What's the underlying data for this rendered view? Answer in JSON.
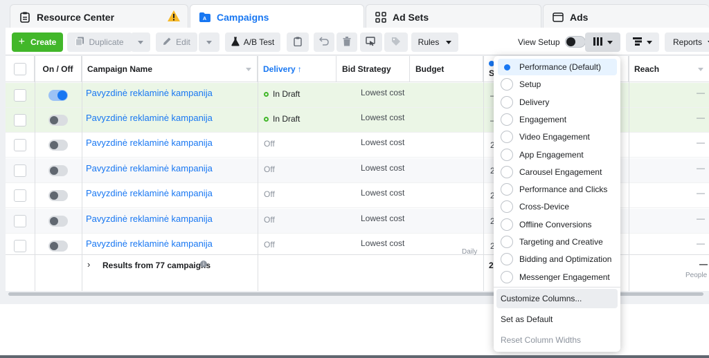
{
  "tabs": {
    "resource_center": "Resource Center",
    "campaigns": "Campaigns",
    "ad_sets": "Ad Sets",
    "ads": "Ads"
  },
  "toolbar": {
    "create": "Create",
    "duplicate": "Duplicate",
    "edit": "Edit",
    "ab_test": "A/B Test",
    "rules": "Rules",
    "view_setup": "View Setup",
    "reports": "Reports"
  },
  "table": {
    "headers": {
      "on_off": "On / Off",
      "campaign_name": "Campaign Name",
      "delivery": "Delivery",
      "bid_strategy": "Bid Strategy",
      "budget": "Budget",
      "results_partial": "S",
      "reach": "Reach"
    },
    "rows": [
      {
        "name": "Pavyzdinė reklaminė kampanija",
        "on": true,
        "delivery": "In Draft",
        "bid": "Lowest cost",
        "results": "—",
        "reach": "—"
      },
      {
        "name": "Pavyzdinė reklaminė kampanija",
        "on": false,
        "delivery": "In Draft",
        "bid": "Lowest cost",
        "results": "—",
        "reach": "—"
      },
      {
        "name": "Pavyzdinė reklaminė kampanija",
        "on": false,
        "delivery": "Off",
        "bid": "Lowest cost",
        "results": "2",
        "reach": "—"
      },
      {
        "name": "Pavyzdinė reklaminė kampanija",
        "on": false,
        "delivery": "Off",
        "bid": "Lowest cost",
        "results": "2",
        "reach": "—"
      },
      {
        "name": "Pavyzdinė reklaminė kampanija",
        "on": false,
        "delivery": "Off",
        "bid": "Lowest cost",
        "results": "2",
        "reach": "—"
      },
      {
        "name": "Pavyzdinė reklaminė kampanija",
        "on": false,
        "delivery": "Off",
        "bid": "Lowest cost",
        "results": "2",
        "reach": "—"
      },
      {
        "name": "Pavyzdinė reklaminė kampanija",
        "on": false,
        "delivery": "Off",
        "bid": "Lowest cost",
        "results": "2",
        "reach": "—"
      }
    ],
    "budget_note": "Daily",
    "summary": {
      "label": "Results from 77 campaigns",
      "results": "2!",
      "reach": "—",
      "reach_unit": "People"
    }
  },
  "columns_menu": {
    "presets": [
      "Performance (Default)",
      "Setup",
      "Delivery",
      "Engagement",
      "Video Engagement",
      "App Engagement",
      "Carousel Engagement",
      "Performance and Clicks",
      "Cross-Device",
      "Offline Conversions",
      "Targeting and Creative",
      "Bidding and Optimization",
      "Messenger Engagement"
    ],
    "selected_index": 0,
    "customize": "Customize Columns...",
    "set_default": "Set as Default",
    "reset_widths": "Reset Column Widths"
  },
  "colors": {
    "accent": "#1877f2",
    "create_green": "#42b72a",
    "draft_row": "#ebf6e6",
    "warning": "#f7b928"
  }
}
